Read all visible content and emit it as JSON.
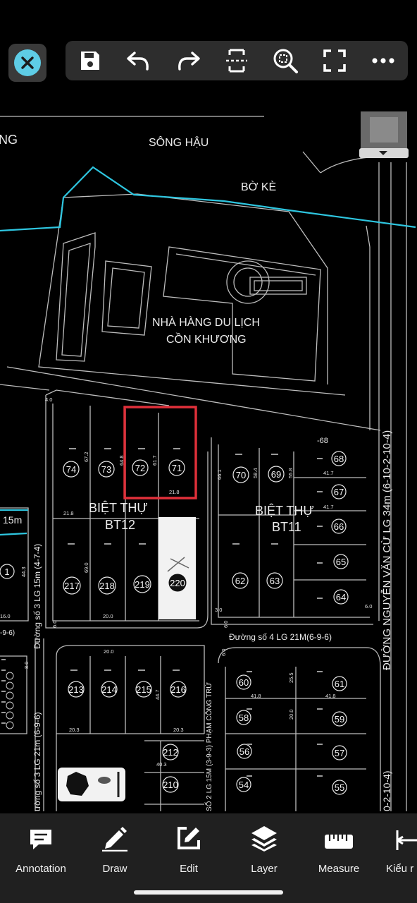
{
  "toolbar": {
    "icons": [
      "close-icon",
      "save-icon",
      "undo-icon",
      "redo-icon",
      "fit-height-icon",
      "zoom-window-icon",
      "fullscreen-icon",
      "more-icon"
    ]
  },
  "drawing": {
    "labels": {
      "river": "SÔNG HẬU",
      "embankment": "BỜ KÈ",
      "left_edge": "NG",
      "restaurant_line1": "NHÀ HÀNG DU LỊCH",
      "restaurant_line2": "CỒN KHƯƠNG",
      "villa_a_line1": "BIỆT THỰ",
      "villa_a_line2": "BT12",
      "villa_b_line1": "BIỆT THỰ",
      "villa_b_line2": "BT11",
      "road_left": "15m",
      "road_3": "Đường số 3 LG 15m (4-7-4)",
      "road_3b": "ường số 3 LG 21m (6-9-6)",
      "road_4": "Đường số 4 LG 21M(6-9-6)",
      "road_2": "SỐ 2 LG 15M (3-9-3) PHẠM CÔNG TRỨ",
      "road_nvc": "ĐƯỜNG NGUYỄN VĂN CỪ LG 34m (6-10-2-10-4)",
      "road_nvc_b": "0-2-10-4)",
      "road_left_b": "-9-6)",
      "lot_number_68_partial": "-68"
    },
    "lots": {
      "bt12_top": [
        "74",
        "73",
        "72",
        "71"
      ],
      "bt12_bottom": [
        "217",
        "218",
        "219",
        "220"
      ],
      "bt11_left": [
        "70",
        "69"
      ],
      "bt11_right": [
        "68",
        "67",
        "66",
        "65",
        "64"
      ],
      "bt11_lower": [
        "62",
        "63"
      ],
      "block_c": [
        "213",
        "214",
        "215",
        "216"
      ],
      "block_c_side": [
        "212",
        "210"
      ],
      "block_d": [
        "60",
        "61",
        "58",
        "59",
        "56",
        "57",
        "54",
        "55"
      ],
      "left_partial": "1"
    },
    "dimensions": {
      "d_4_0": "4.0",
      "d_67_2": "67.2",
      "d_64_8": "64.8",
      "d_61_7": "61.7",
      "d_21_8": "21.8",
      "d_21_8b": "21.8",
      "d_69_0": "69.0",
      "d_20_0": "20.0",
      "d_44_3": "44.3",
      "d_16_0": "16.0",
      "d_6_0": "6.0",
      "d_66_1": "66.1",
      "d_58_4": "58.4",
      "d_55_8": "55.8",
      "d_41_7": "41.7",
      "d_41_7b": "41.7",
      "d_3_0": "3.0",
      "d_6_0b": "6.0",
      "d_6_0c": "6.0",
      "d_20_0b": "20.0",
      "d_44_7": "44.7",
      "d_20_3": "20.3",
      "d_20_3b": "20.3",
      "d_40_3": "40.3",
      "d_41_8": "41.8",
      "d_41_8b": "41.8",
      "d_25_5": "25.5",
      "d_20_0c": "20.0",
      "d_8_0": "8.0",
      "d_6_0d": "6.0"
    }
  },
  "bottom_tabs": [
    {
      "label": "Annotation",
      "icon": "annotation-icon"
    },
    {
      "label": "Draw",
      "icon": "pencil-icon"
    },
    {
      "label": "Edit",
      "icon": "edit-icon"
    },
    {
      "label": "Layer",
      "icon": "layers-icon"
    },
    {
      "label": "Measure",
      "icon": "ruler-icon"
    },
    {
      "label": "Kiểu r",
      "icon": "dimension-icon"
    }
  ],
  "colors": {
    "accent": "#5ecde6",
    "selection": "#e0303a",
    "cyan_line": "#2ec6e0",
    "line": "#c8c8c8",
    "toolbar": "#2d2d2d",
    "bottom_bar": "#202020"
  }
}
